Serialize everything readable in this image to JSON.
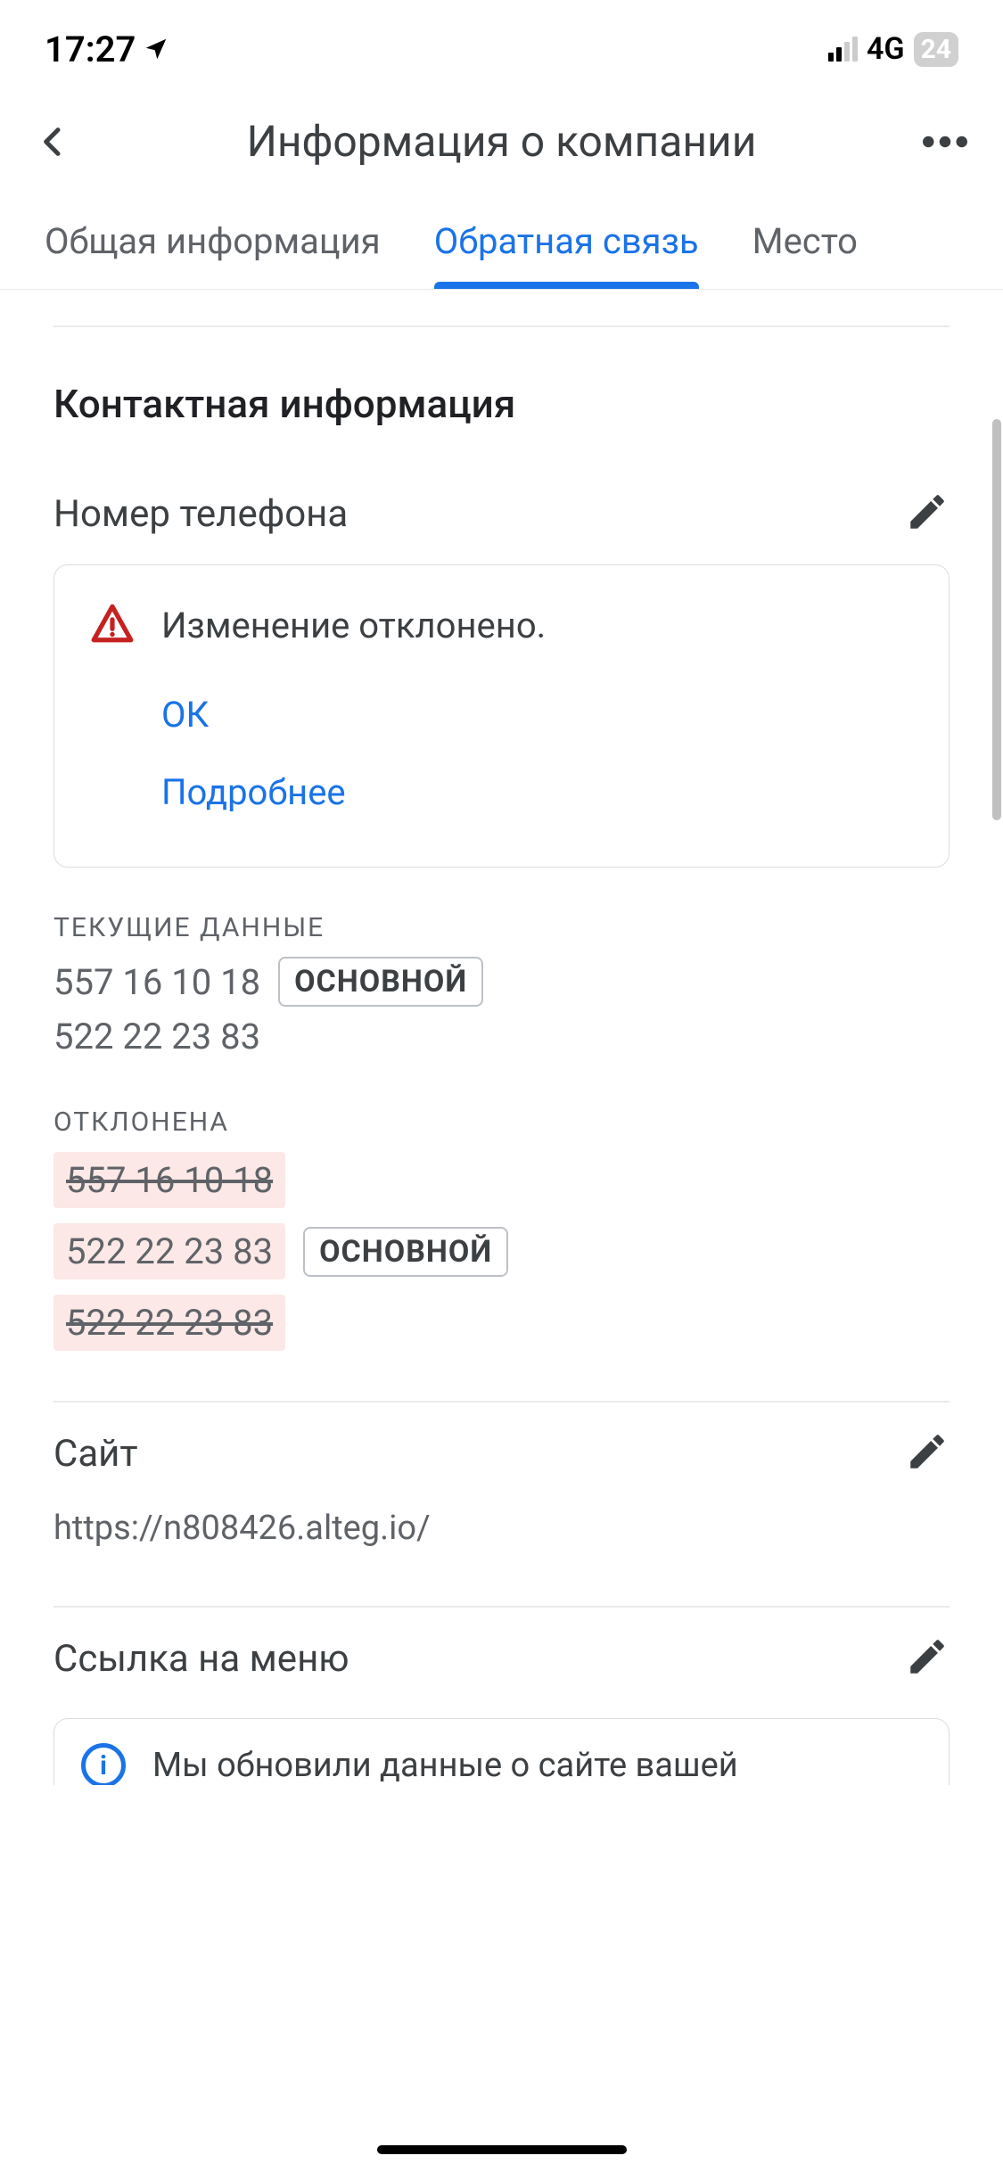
{
  "status": {
    "time": "17:27",
    "network": "4G",
    "battery": "24"
  },
  "header": {
    "title": "Информация о компании"
  },
  "tabs": {
    "general": "Общая информация",
    "feedback": "Обратная связь",
    "location": "Место"
  },
  "section": {
    "title": "Контактная информация"
  },
  "phone": {
    "label": "Номер телефона",
    "alert": {
      "message": "Изменение отклонено.",
      "ok": "ОК",
      "more": "Подробнее"
    },
    "current_label": "ТЕКУЩИЕ ДАННЫЕ",
    "current": {
      "primary": "557 16 10 18",
      "primary_badge": "ОСНОВНОЙ",
      "secondary": "522 22 23 83"
    },
    "rejected_label": "ОТКЛОНЕНА",
    "rejected": {
      "r1": "557 16 10 18",
      "r2": "522 22 23 83",
      "r2_badge": "ОСНОВНОЙ",
      "r3": "522 22 23 83"
    }
  },
  "website": {
    "label": "Сайт",
    "url": "https://n808426.alteg.io/"
  },
  "menu_link": {
    "label": "Ссылка на меню",
    "info_text": "Мы обновили данные о сайте вашей"
  }
}
